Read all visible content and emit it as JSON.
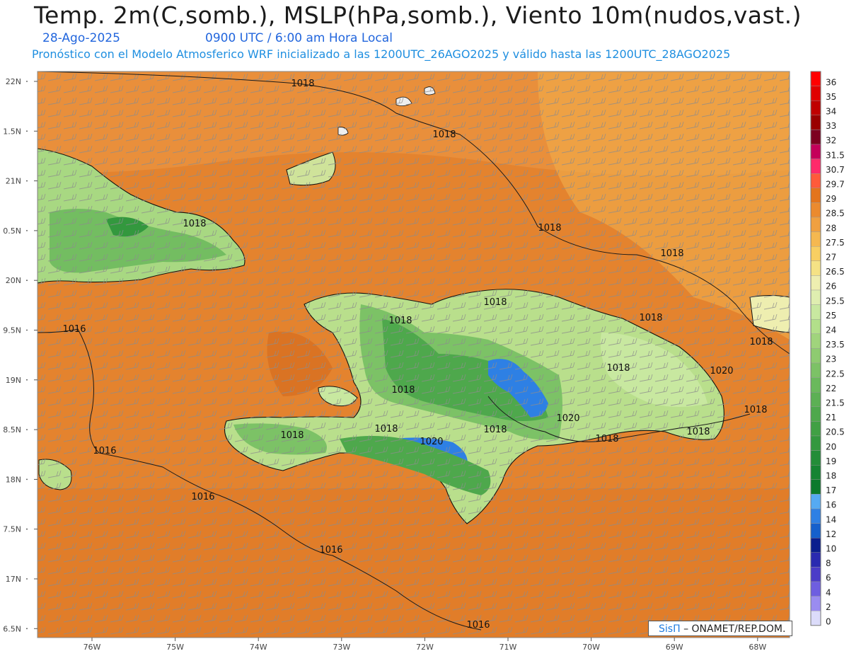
{
  "header": {
    "title": "Temp. 2m(C,somb.), MSLP(hPa,somb.), Viento 10m(nudos,vast.)",
    "date": "28-Ago-2025",
    "time": "0900 UTC / 6:00 am Hora Local",
    "subtitle": "Pronóstico con el Modelo Atmosferico WRF inicializado a las 1200UTC_26AGO2025 y válido hasta las  1200UTC_28AGO2025"
  },
  "axes": {
    "lat_labels": [
      "22N",
      "1.5N",
      "21N",
      "0.5N",
      "20N",
      "9.5N",
      "19N",
      "8.5N",
      "18N",
      "7.5N",
      "17N",
      "6.5N"
    ],
    "lon_labels": [
      "76W",
      "75W",
      "74W",
      "73W",
      "72W",
      "71W",
      "70W",
      "69W",
      "68W"
    ]
  },
  "isobars": [
    {
      "label": "1018"
    },
    {
      "label": "1018"
    },
    {
      "label": "1018"
    },
    {
      "label": "1018"
    },
    {
      "label": "1018"
    },
    {
      "label": "1018"
    },
    {
      "label": "1018"
    },
    {
      "label": "1018"
    },
    {
      "label": "1018"
    },
    {
      "label": "1018"
    },
    {
      "label": "1018"
    },
    {
      "label": "1018"
    },
    {
      "label": "1018"
    },
    {
      "label": "1018"
    },
    {
      "label": "1018"
    },
    {
      "label": "1018"
    },
    {
      "label": "1018"
    },
    {
      "label": "1020"
    },
    {
      "label": "1020"
    },
    {
      "label": "1020"
    },
    {
      "label": "1016"
    },
    {
      "label": "1016"
    },
    {
      "label": "1016"
    },
    {
      "label": "1016"
    },
    {
      "label": "1016"
    }
  ],
  "colorbar": {
    "levels": [
      {
        "label": "36",
        "color": "#ff0000"
      },
      {
        "label": "35",
        "color": "#e00000"
      },
      {
        "label": "34",
        "color": "#c00000"
      },
      {
        "label": "33",
        "color": "#9a0000"
      },
      {
        "label": "32",
        "color": "#7d0020"
      },
      {
        "label": "31.5",
        "color": "#c4005a"
      },
      {
        "label": "30.7",
        "color": "#ff2a6a"
      },
      {
        "label": "29.7",
        "color": "#ff5a3a"
      },
      {
        "label": "29",
        "color": "#e3741c"
      },
      {
        "label": "28.5",
        "color": "#eb8a2e"
      },
      {
        "label": "28",
        "color": "#f0a040"
      },
      {
        "label": "27.5",
        "color": "#f5b850"
      },
      {
        "label": "27",
        "color": "#f8cf62"
      },
      {
        "label": "26.5",
        "color": "#f5e285"
      },
      {
        "label": "26",
        "color": "#eeeeb0"
      },
      {
        "label": "25.5",
        "color": "#dfeeb0"
      },
      {
        "label": "25",
        "color": "#c8e8a0"
      },
      {
        "label": "24",
        "color": "#b2df8a"
      },
      {
        "label": "23.5",
        "color": "#a0d47c"
      },
      {
        "label": "23",
        "color": "#8ecb70"
      },
      {
        "label": "22.5",
        "color": "#7cc266"
      },
      {
        "label": "22",
        "color": "#6ab95c"
      },
      {
        "label": "21.5",
        "color": "#5cb054"
      },
      {
        "label": "21",
        "color": "#4ea84c"
      },
      {
        "label": "20.5",
        "color": "#40a044"
      },
      {
        "label": "20",
        "color": "#33983e"
      },
      {
        "label": "19",
        "color": "#238d38"
      },
      {
        "label": "18",
        "color": "#168432"
      },
      {
        "label": "17",
        "color": "#0c7a2c"
      },
      {
        "label": "16",
        "color": "#55aaf2"
      },
      {
        "label": "14",
        "color": "#2e80e4"
      },
      {
        "label": "12",
        "color": "#1560cc"
      },
      {
        "label": "10",
        "color": "#0a1e8e"
      },
      {
        "label": "8",
        "color": "#2a2ab0"
      },
      {
        "label": "6",
        "color": "#4b3cc8"
      },
      {
        "label": "4",
        "color": "#6e5ee0"
      },
      {
        "label": "2",
        "color": "#9a8cf0"
      },
      {
        "label": "0",
        "color": "#dcdcfa"
      }
    ]
  },
  "credit": {
    "sis": "SisΠ",
    "org": "– ONAMET/REP.DOM."
  },
  "colors": {
    "sea": "#e4832e",
    "land_low": "#b9df8c",
    "land_mid": "#6ab95c",
    "land_high": "#2e80e4",
    "isobar": "#1a1a1a",
    "barb": "#8a8a8a"
  }
}
